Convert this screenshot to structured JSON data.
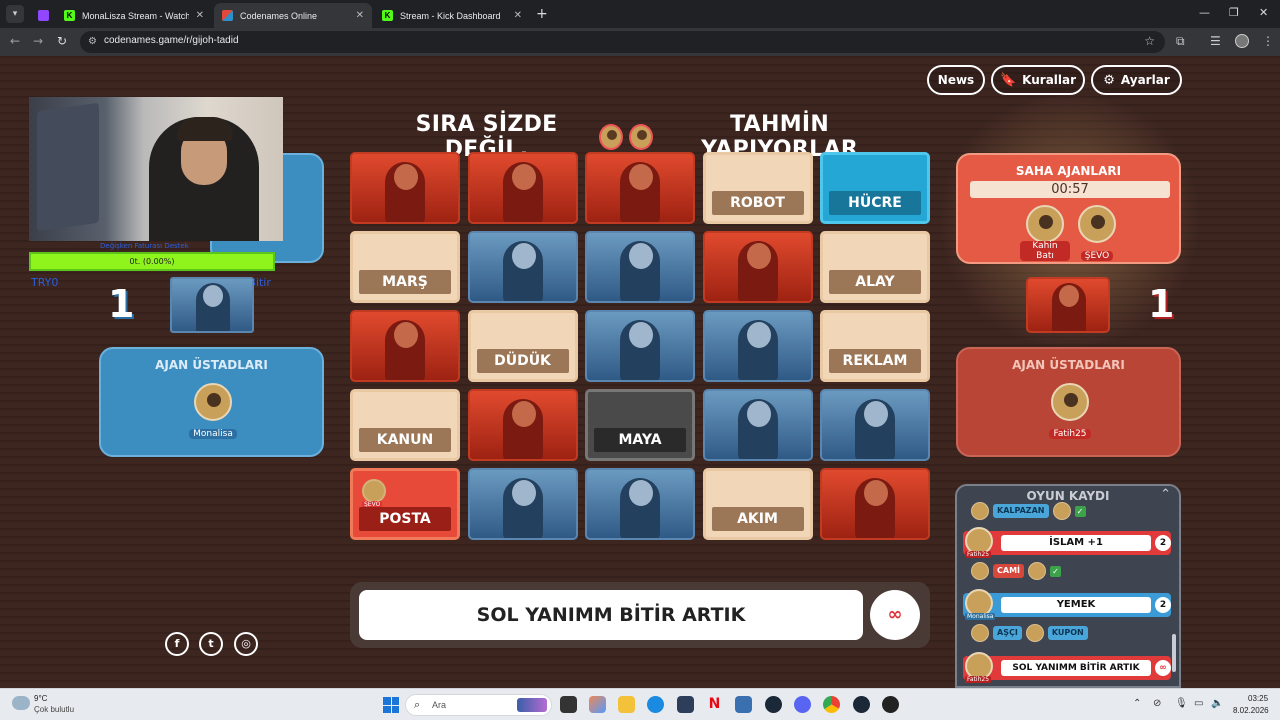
{
  "browser": {
    "tabs": [
      {
        "label": "MonaLisza Stream - Watch Live",
        "active": false
      },
      {
        "label": "Codenames Online",
        "active": true
      },
      {
        "label": "Stream - Kick Dashboard",
        "active": false
      }
    ],
    "url": "codenames.game/r/gijoh-tadid"
  },
  "header": {
    "news_label": "News",
    "rules_label": "Kurallar",
    "settings_label": "Ayarlar"
  },
  "turn": {
    "before": "SIRA SİZDE DEĞİL,",
    "after": "TAHMİN YAPIYORLAR",
    "players": [
      "Kahin Batı",
      "ŞEVO"
    ]
  },
  "board": [
    {
      "type": "red-agent"
    },
    {
      "type": "red-agent"
    },
    {
      "type": "red-agent"
    },
    {
      "type": "word",
      "word": "ROBOT"
    },
    {
      "type": "cyan",
      "word": "HÜCRE"
    },
    {
      "type": "word",
      "word": "MARŞ"
    },
    {
      "type": "blue-agent"
    },
    {
      "type": "blue-agent"
    },
    {
      "type": "red-agent"
    },
    {
      "type": "word",
      "word": "ALAY"
    },
    {
      "type": "red-agent"
    },
    {
      "type": "word",
      "word": "DÜDÜK"
    },
    {
      "type": "blue-agent"
    },
    {
      "type": "blue-agent"
    },
    {
      "type": "word",
      "word": "REKLAM"
    },
    {
      "type": "word",
      "word": "KANUN"
    },
    {
      "type": "red-agent"
    },
    {
      "type": "gray",
      "word": "MAYA"
    },
    {
      "type": "blue-agent"
    },
    {
      "type": "blue-agent"
    },
    {
      "type": "redword",
      "word": "POSTA",
      "marker": "ŞEVO"
    },
    {
      "type": "blue-agent"
    },
    {
      "type": "blue-agent"
    },
    {
      "type": "word",
      "word": "AKIM"
    },
    {
      "type": "red-agent"
    }
  ],
  "clue": {
    "text": "SOL YANIMM BİTİR ARTIK",
    "count": "∞"
  },
  "blue_team": {
    "score": "1",
    "stream_overlay": "Değişken Faturası Destek",
    "progress": "0t. (0.00%)",
    "progress_fraction": 0.0,
    "try_left": "TRY0",
    "try_right": "TRY1000Bitir",
    "spymasters_title": "AJAN ÜSTADLARI",
    "spymaster": "Monalisa"
  },
  "red_team": {
    "score": "1",
    "operatives_title": "SAHA AJANLARI",
    "timer": "00:57",
    "operatives": [
      "Kahin Batı",
      "ŞEVO"
    ],
    "spymasters_title": "AJAN ÜSTADLARI",
    "spymaster": "Fatih25"
  },
  "log": {
    "title": "OYUN KAYDI",
    "entries": [
      {
        "chip": "KALPAZAN",
        "color": "blue"
      },
      {
        "clue_by": "Fatih25",
        "word": "İSLAM +1",
        "count": "2",
        "color": "red"
      },
      {
        "chip": "CAMİ",
        "color": "red"
      },
      {
        "clue_by": "Monalisa",
        "word": "YEMEK",
        "count": "2",
        "color": "blue"
      },
      {
        "chip": "AŞÇI",
        "color": "blue"
      },
      {
        "chip": "KUPON",
        "color": "blue"
      },
      {
        "clue_by": "Fatih25",
        "word": "SOL YANIMM BİTİR ARTIK",
        "count": "∞",
        "color": "red"
      }
    ]
  },
  "taskbar": {
    "temperature": "9°C",
    "weather": "Çok bulutlu",
    "search_placeholder": "Ara",
    "time": "03:25",
    "date": "8.02.2026"
  },
  "colors": {
    "red": "#e84a3a",
    "blue": "#3d8ec0",
    "word_card": "#f1d6b8",
    "background": "#3d2520"
  }
}
